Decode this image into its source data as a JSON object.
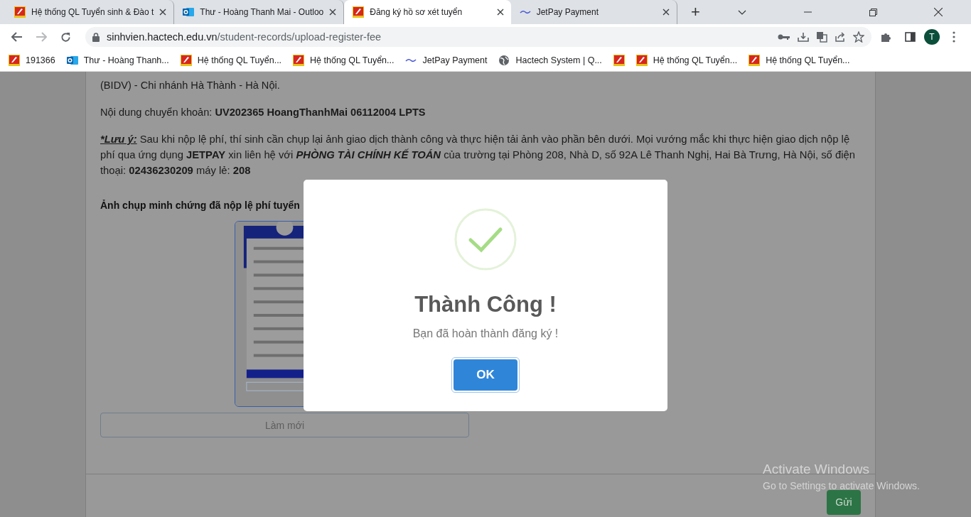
{
  "tabs": [
    {
      "title": "Hệ thống QL Tuyển sinh & Đào t",
      "kind": "school",
      "selected": false
    },
    {
      "title": "Thư - Hoàng Thanh Mai - Outloo",
      "kind": "mail",
      "selected": false
    },
    {
      "title": "Đăng ký hồ sơ xét tuyển",
      "kind": "school",
      "selected": true
    },
    {
      "title": "JetPay Payment",
      "kind": "payment",
      "selected": false
    }
  ],
  "new_tab": "+",
  "address": {
    "host": "sinhvien.hactech.edu.vn",
    "path": "/student-records/upload-register-fee"
  },
  "profile": "T",
  "bookmarks": [
    {
      "label": "191366",
      "kind": "school"
    },
    {
      "label": "Thư - Hoàng Thanh...",
      "kind": "mail"
    },
    {
      "label": "Hệ thống QL Tuyển...",
      "kind": "school"
    },
    {
      "label": "Hệ thống QL Tuyển...",
      "kind": "school"
    },
    {
      "label": "JetPay Payment",
      "kind": "payment"
    },
    {
      "label": "Hactech System | Q...",
      "kind": "web"
    },
    {
      "kind": "school"
    },
    {
      "label": "Hệ thống QL Tuyển...",
      "kind": "school"
    },
    {
      "label": "Hệ thống QL Tuyển...",
      "kind": "school"
    }
  ],
  "page": {
    "paragraphs": [
      "(BIDV) - Chi nhánh Hà Thành - Hà Nội.",
      "Nội dung chuyển khoản: **UV202365 HoangThanhMai 06112004 LPTS**"
    ],
    "note": {
      "label": "*Lưu ý:",
      "text": "Sau khi nộp lệ phí, thí sinh cần chụp lại ảnh giao dịch thành công và thực hiện tải ảnh vào phần bên dưới. Mọi vướng mắc khi thực hiện giao dịch nộp lệ phí qua ứng dụng **JETPAY** xin liên hệ với *PHÒNG TÀI CHÍNH KẾ TOÁN* của trường tại Phòng 208, Nhà D, số 92A Lê Thanh Nghị, Hai Bà Trưng, Hà Nội, số điện thoại: **02436230209** máy lẻ: **208**"
    },
    "upload_label": "Ảnh chụp minh chứng đã nộp lệ phí tuyển",
    "reset_button": "Làm mới",
    "submit_button": "Gửi"
  },
  "dialog": {
    "title": "Thành Công !",
    "message": "Bạn đã hoàn thành đăng ký !",
    "ok_button": "OK"
  },
  "os_notice": {
    "title": "Activate Windows",
    "message": "Go to Settings to activate Windows."
  }
}
